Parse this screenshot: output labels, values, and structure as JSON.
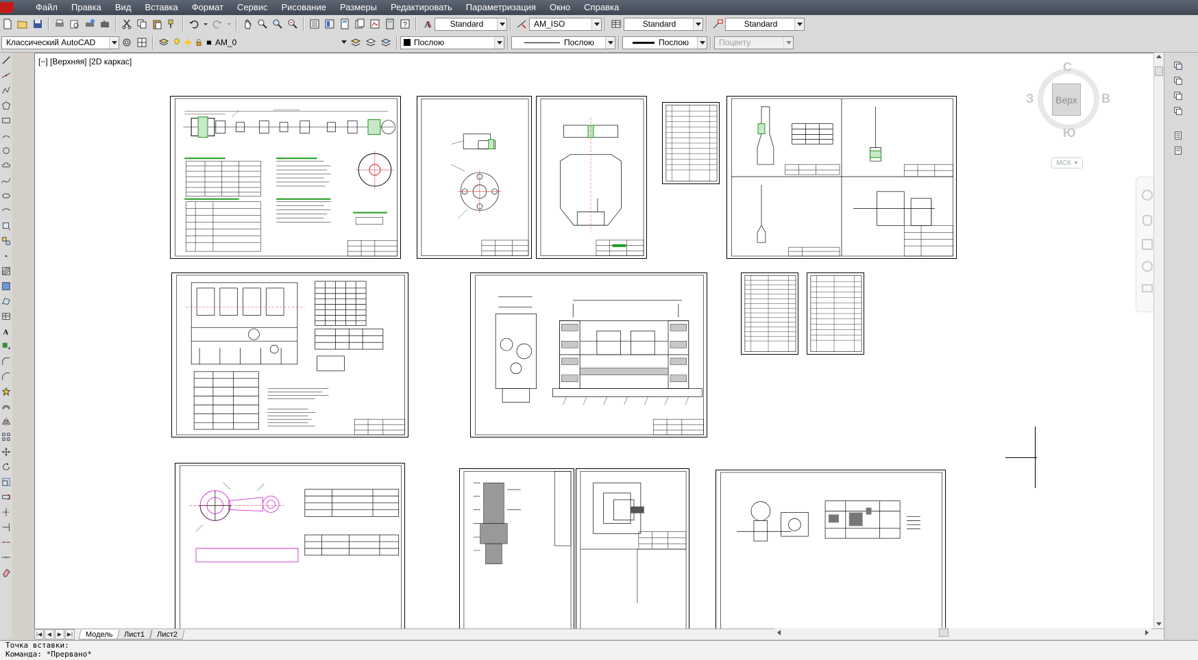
{
  "menu": [
    "Файл",
    "Правка",
    "Вид",
    "Вставка",
    "Формат",
    "Сервис",
    "Рисование",
    "Размеры",
    "Редактировать",
    "Параметризация",
    "Окно",
    "Справка"
  ],
  "toolbar1": {
    "text_style": "Standard",
    "dim_style": "AM_ISO",
    "table_style": "Standard",
    "multileader_style": "Standard"
  },
  "toolbar2": {
    "workspace": "Классический AutoCAD",
    "layer": "AM_0",
    "color": "Послою",
    "linetype": "Послою",
    "lineweight": "Послою",
    "plotstyle": "Поцвету"
  },
  "viewport_label": "[−] [Верхняя] [2D каркас]",
  "viewcube": {
    "north": "С",
    "south": "Ю",
    "east": "В",
    "west": "З",
    "face": "Верх",
    "wcs": "МСК"
  },
  "tabs": [
    "Модель",
    "Лист1",
    "Лист2"
  ],
  "active_tab": "Модель",
  "command_lines": [
    "Точка вставки:",
    "Команда: *Прервано*"
  ],
  "colors": {
    "menubar": "#4a525e",
    "canvas": "#ffffff",
    "drawing_green": "#1a9a1a",
    "drawing_red": "#d02020",
    "drawing_magenta": "#d030d0"
  }
}
